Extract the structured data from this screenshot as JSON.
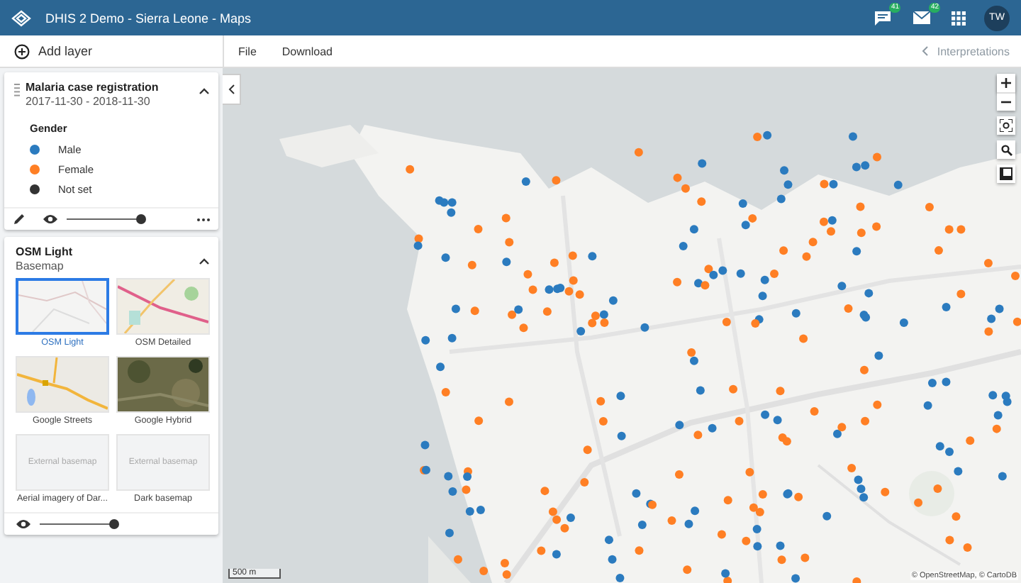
{
  "header": {
    "title": "DHIS 2 Demo - Sierra Leone - Maps",
    "interpretation_count": "41",
    "message_count": "42",
    "avatar": "TW"
  },
  "toolbar": {
    "add_layer": "Add layer",
    "menu": [
      "File",
      "Download"
    ],
    "interpretations": {
      "label": "Interpretations",
      "disabled": true
    }
  },
  "layers": [
    {
      "title": "Malaria case registration",
      "subtitle": "2017-11-30 - 2018-11-30",
      "expanded": true,
      "legend_title": "Gender",
      "legend": [
        {
          "label": "Male",
          "color": "#2b7bbf"
        },
        {
          "label": "Female",
          "color": "#ff7f24"
        },
        {
          "label": "Not set",
          "color": "#333333"
        }
      ],
      "opacity": {
        "level": 1
      }
    }
  ],
  "basemap": {
    "title": "OSM Light",
    "subtitle": "Basemap",
    "expanded": true,
    "options": [
      {
        "label": "OSM Light",
        "kind": "light",
        "selected": true
      },
      {
        "label": "OSM Detailed",
        "kind": "detailed",
        "selected": false
      },
      {
        "label": "Google Streets",
        "kind": "streets",
        "selected": false
      },
      {
        "label": "Google Hybrid",
        "kind": "hybrid",
        "selected": false
      },
      {
        "label": "Aerial imagery of Dar...",
        "kind": "external",
        "placeholder": "External basemap",
        "selected": false
      },
      {
        "label": "Dark basemap",
        "kind": "external",
        "placeholder": "External basemap",
        "selected": false
      }
    ],
    "opacity": {
      "level": 1
    }
  },
  "map": {
    "scale": "500 m",
    "attribution": "© OpenStreetMap, © CartoDB"
  }
}
